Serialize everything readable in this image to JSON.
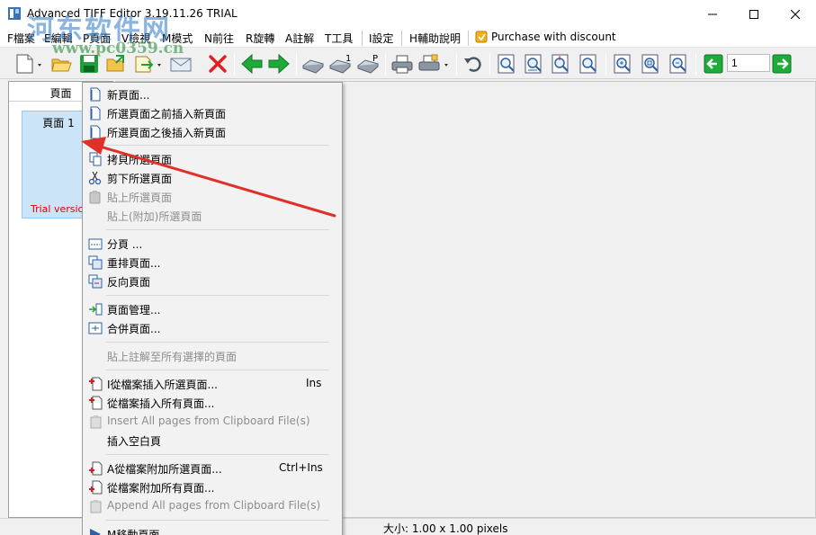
{
  "window": {
    "title": "Advanced TIFF Editor 3.19.11.26 TRIAL",
    "controls": [
      "minimize",
      "maximize",
      "close"
    ]
  },
  "watermark": {
    "text": "河东软件网",
    "url": "www.pc0359.cn"
  },
  "menubar": {
    "items": [
      {
        "label": "F檔案"
      },
      {
        "label": "E編輯"
      },
      {
        "label": "P頁面"
      },
      {
        "label": "V檢視"
      },
      {
        "label": "M模式"
      },
      {
        "label": "N前往"
      },
      {
        "label": "R旋轉"
      },
      {
        "label": "A註解"
      },
      {
        "label": "T工具"
      },
      {
        "label": "I設定"
      },
      {
        "label": "H輔助說明"
      },
      {
        "label": "Purchase with discount"
      }
    ]
  },
  "toolbar": {
    "page_number": "1",
    "icons": [
      "new-page-icon",
      "open-folder-icon",
      "save-icon",
      "export-icon",
      "send-icon",
      "email-icon",
      "delete-icon",
      "back-green-icon",
      "forward-green-icon",
      "scan-icon",
      "scan-multi-icon",
      "scan-settings-icon",
      "print-icon",
      "print-setup-icon",
      "undo-icon",
      "zoom-in-icon",
      "zoom-out-icon",
      "fit-height-icon",
      "fit-width-icon",
      "zoom-plus-icon",
      "zoom-page-icon",
      "zoom-minus-icon",
      "prev-page-icon",
      "next-page-icon"
    ]
  },
  "left_panel": {
    "header": "頁面",
    "thumbnail": {
      "label": "頁面 1",
      "trial_text": "Trial version"
    }
  },
  "status": {
    "size": "大小: 1.00 x 1.00 pixels"
  },
  "context_menu": {
    "items": [
      {
        "label": "新頁面...",
        "icon": "new-page-icon",
        "enabled": true
      },
      {
        "label": "所選頁面之前插入新頁面",
        "icon": "new-page-icon",
        "enabled": true
      },
      {
        "label": "所選頁面之後插入新頁面",
        "icon": "new-page-icon",
        "enabled": true
      },
      {
        "label": "拷貝所選頁面",
        "icon": "copy-icon",
        "enabled": true
      },
      {
        "label": "剪下所選頁面",
        "icon": "scissors-icon",
        "enabled": true
      },
      {
        "label": "貼上所選頁面",
        "icon": "paste-icon",
        "enabled": false
      },
      {
        "label": "貼上(附加)所選頁面",
        "icon": "",
        "enabled": false
      },
      {
        "label": "分頁 ...",
        "icon": "split-icon",
        "enabled": true
      },
      {
        "label": "重排頁面...",
        "icon": "reorder-icon",
        "enabled": true
      },
      {
        "label": "反向頁面",
        "icon": "reverse-icon",
        "enabled": true
      },
      {
        "label": "頁面管理...",
        "icon": "page-manager-icon",
        "enabled": true
      },
      {
        "label": "合併頁面...",
        "icon": "merge-icon",
        "enabled": true
      },
      {
        "label": "貼上註解至所有選擇的頁面",
        "icon": "",
        "enabled": false
      },
      {
        "label": "I從檔案插入所選頁面...",
        "icon": "insert-file-icon",
        "enabled": true,
        "shortcut": "Ins"
      },
      {
        "label": "從檔案插入所有頁面...",
        "icon": "insert-file-icon",
        "enabled": true
      },
      {
        "label": "Insert All pages from Clipboard File(s)",
        "icon": "clipboard-icon",
        "enabled": false
      },
      {
        "label": "插入空白頁",
        "icon": "",
        "enabled": true
      },
      {
        "label": "A從檔案附加所選頁面...",
        "icon": "append-file-icon",
        "enabled": true,
        "shortcut": "Ctrl+Ins"
      },
      {
        "label": "從檔案附加所有頁面...",
        "icon": "append-file-icon",
        "enabled": true
      },
      {
        "label": "Append All pages from Clipboard File(s)",
        "icon": "clipboard-icon",
        "enabled": false
      },
      {
        "label": "M移動頁面",
        "icon": "move-icon",
        "enabled": true
      }
    ]
  },
  "colors": {
    "accent": "#0078d7",
    "arrow": "#e0302a",
    "trial": "#e00000",
    "thumb_selected": "#cce4f7"
  }
}
